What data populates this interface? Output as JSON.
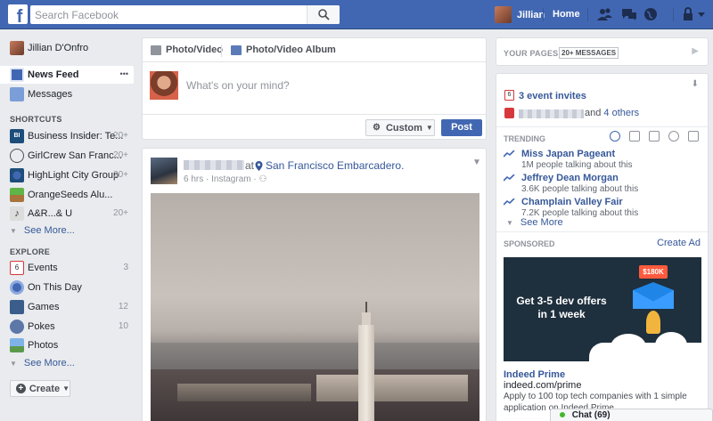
{
  "topbar": {
    "search_placeholder": "Search Facebook",
    "user_name": "Jillian",
    "home_label": "Home",
    "brand_color": "#4267b2"
  },
  "leftnav": {
    "profile_name": "Jillian D'Onfro",
    "items": [
      {
        "label": "News Feed",
        "icon": "news-feed-icon"
      },
      {
        "label": "Messages",
        "icon": "messages-icon"
      }
    ],
    "more_dots": "•••",
    "shortcuts_heading": "SHORTCUTS",
    "shortcuts": [
      {
        "label": "Business Insider: Te...",
        "count": "20+",
        "icon": "business-insider-icon"
      },
      {
        "label": "GirlCrew San Franc...",
        "count": "20+",
        "icon": "girlcrew-icon"
      },
      {
        "label": "HighLight City Group",
        "count": "20+",
        "icon": "highlight-icon"
      },
      {
        "label": "OrangeSeeds Alu...",
        "count": "",
        "icon": "orangeseeds-icon"
      },
      {
        "label": "A&R...& U",
        "count": "20+",
        "icon": "music-icon"
      }
    ],
    "see_more_1": "See More...",
    "explore_heading": "EXPLORE",
    "explore": [
      {
        "label": "Events",
        "count": "3",
        "icon": "calendar-icon"
      },
      {
        "label": "On This Day",
        "count": "",
        "icon": "on-this-day-icon"
      },
      {
        "label": "Games",
        "count": "12",
        "icon": "games-icon"
      },
      {
        "label": "Pokes",
        "count": "10",
        "icon": "pokes-icon"
      },
      {
        "label": "Photos",
        "count": "",
        "icon": "photos-icon"
      }
    ],
    "see_more_2": "See More...",
    "create_label": "Create"
  },
  "composer": {
    "tab_photo_video": "Photo/Video",
    "tab_album": "Photo/Video Album",
    "placeholder": "What's on your mind?",
    "audience_label": "Custom",
    "post_label": "Post"
  },
  "post": {
    "at_label": "at",
    "location": "San Francisco Embarcadero.",
    "meta": "6 hrs · Instagram ·"
  },
  "rightcol": {
    "your_pages": "YOUR PAGES",
    "messages_badge": "20+ MESSAGES",
    "event_day": "6",
    "event_invites": "3 event invites",
    "birthday_and": "and",
    "birthday_others": "4 others",
    "trending_heading": "TRENDING",
    "trending": [
      {
        "title": "Miss Japan Pageant",
        "subtitle": "1M people talking about this"
      },
      {
        "title": "Jeffrey Dean Morgan",
        "subtitle": "3.6K people talking about this"
      },
      {
        "title": "Champlain Valley Fair",
        "subtitle": "7.2K people talking about this"
      }
    ],
    "see_more": "See More",
    "sponsored_heading": "SPONSORED",
    "create_ad": "Create Ad",
    "ad_headline": "Get 3-5 dev offers in 1 week",
    "ad_bubble": "$180K",
    "ad_title": "Indeed Prime",
    "ad_url": "indeed.com/prime",
    "ad_desc": "Apply to 100 top tech companies with 1 simple application on Indeed Prime"
  },
  "chat": {
    "label": "Chat (69)"
  }
}
